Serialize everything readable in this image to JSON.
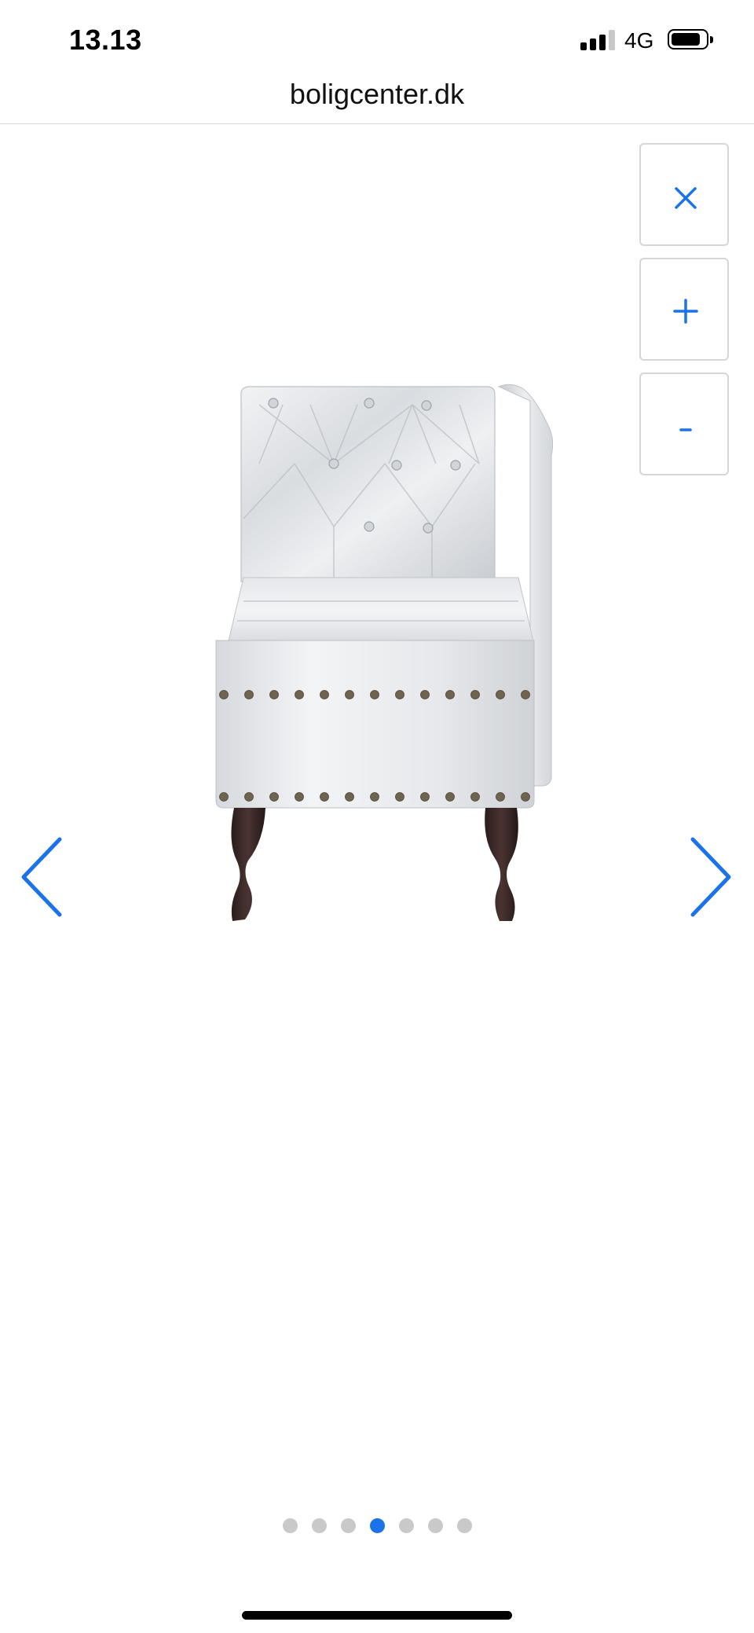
{
  "status_bar": {
    "time": "13.13",
    "network": "4G",
    "signal_bars_filled": 3,
    "signal_bars_total": 4,
    "battery_level": 0.8
  },
  "browser": {
    "url": "boligcenter.dk"
  },
  "gallery": {
    "controls": {
      "close_label": "close-icon",
      "zoom_in_label": "plus-icon",
      "zoom_out_label": "minus-icon"
    },
    "image": {
      "subject": "chaise-longue-icon"
    },
    "prev_icon": "chevron-left-icon",
    "next_icon": "chevron-right-icon",
    "total_images": 7,
    "current_index": 4
  },
  "colors": {
    "accent": "#1a73e8",
    "dot_inactive": "#c9c9c9",
    "divider": "#d9d9d9"
  }
}
